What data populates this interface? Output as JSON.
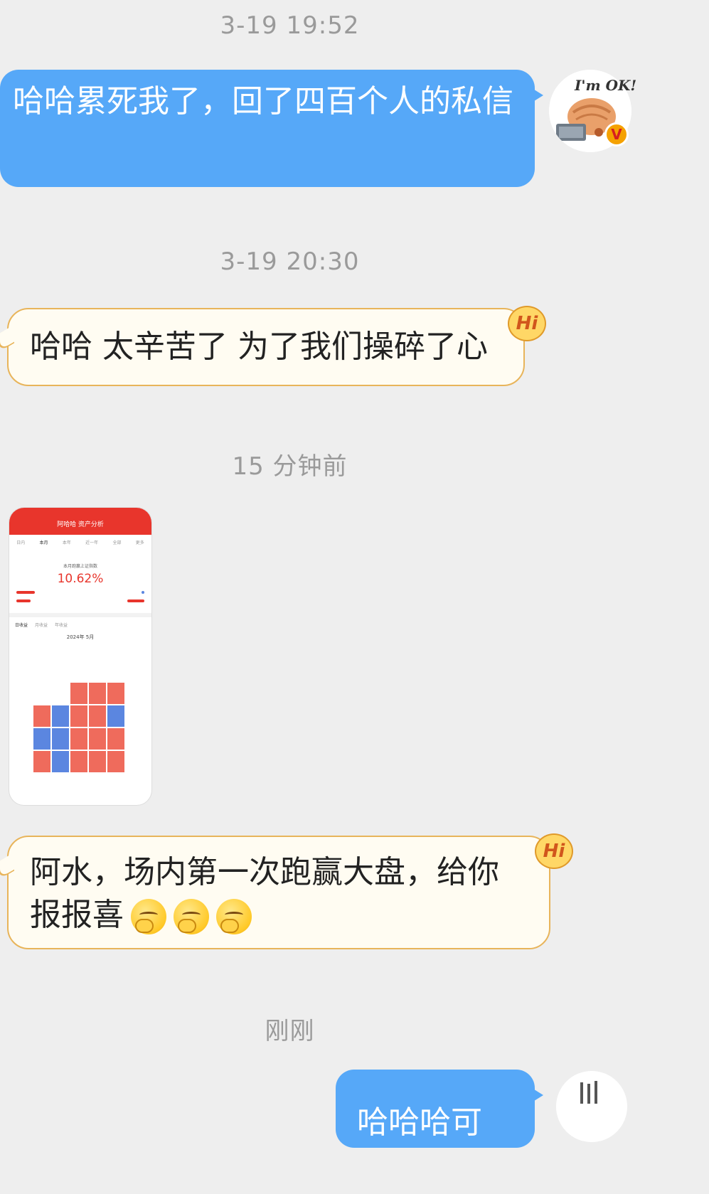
{
  "timestamps": [
    "3-19 19:52",
    "3-19 20:30",
    "15 分钟前",
    "刚刚"
  ],
  "messages": {
    "m1": "哈哈累死我了，回了四百个人的私信",
    "m2": "哈哈  太辛苦了  为了我们操碎了心",
    "m4_text": "阿水，场内第一次跑赢大盘，给你报报喜",
    "m5": "哈哈哈可"
  },
  "avatar": {
    "sticker_text": "I'm OK!",
    "verified_badge": "V"
  },
  "hi_badge": "Hi",
  "emojis": [
    "thinking-emoji",
    "thinking-emoji",
    "thinking-emoji"
  ],
  "shared_image": {
    "header": "阿哈哈 资产分析",
    "tabs": [
      "日内",
      "本月",
      "本年",
      "近一年",
      "全部",
      "更多"
    ],
    "metric_label": "本月跑赢上证指数",
    "metric_value": "10.62%",
    "subtabs": [
      "日收益",
      "月收益",
      "年收益"
    ],
    "month": "2024年 5月"
  },
  "colors": {
    "outgoing_bubble": "#56a8f8",
    "incoming_border": "#e8b45a",
    "accent_red": "#e8352c"
  }
}
